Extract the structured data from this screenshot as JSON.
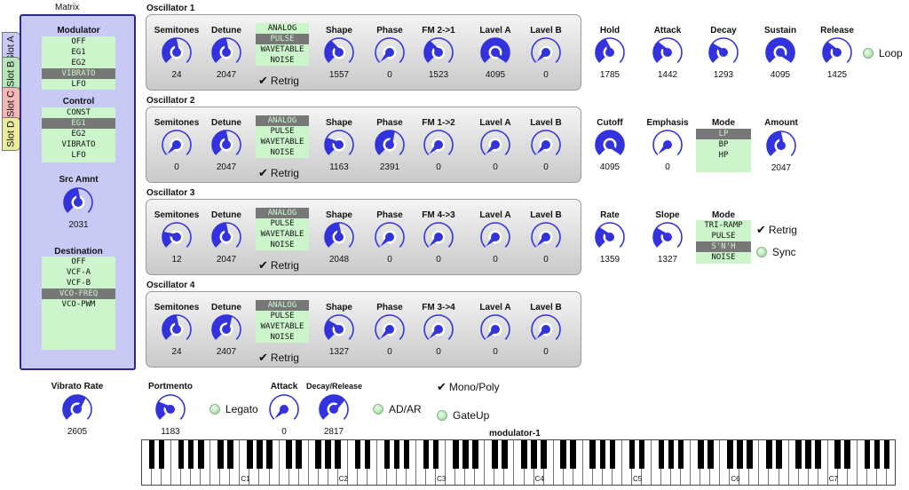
{
  "colors": {
    "knob_fill": "#3333dd",
    "lcd_bg": "#ccf5cc",
    "lcd_selected": "#777777",
    "matrix_bg": "#c9c9f5"
  },
  "matrix": {
    "title": "Matrix",
    "tabs": [
      {
        "label": "Slot A",
        "color": "#c9c9f5"
      },
      {
        "label": "Slot B",
        "color": "#b8e6b8"
      },
      {
        "label": "Slot C",
        "color": "#f2b8b8"
      },
      {
        "label": "Slot D",
        "color": "#ecec9c"
      }
    ],
    "modulator": {
      "label": "Modulator",
      "options": [
        "OFF",
        "EG1",
        "EG2",
        "VIBRATO",
        "LFO"
      ],
      "selected": 3
    },
    "control": {
      "label": "Control",
      "options": [
        "CONST",
        "EG1",
        "EG2",
        "VIBRATO",
        "LFO"
      ],
      "selected": 1
    },
    "src_amnt": {
      "label": "Src Amnt",
      "value": "2031",
      "fraction": 0.5
    },
    "destination": {
      "label": "Destination",
      "options": [
        "OFF",
        "VCF-A",
        "VCF-B",
        "VCO-FREQ",
        "VCO-PWM"
      ],
      "selected": 3
    }
  },
  "wave_options": [
    "ANALOG",
    "PULSE",
    "WAVETABLE",
    "NOISE"
  ],
  "oscillators": [
    {
      "title": "Oscillator 1",
      "wave_selected": 1,
      "retrig": "Retrig",
      "knobs": [
        {
          "label": "Semitones",
          "value": "24",
          "fraction": 0.5
        },
        {
          "label": "Detune",
          "value": "2047",
          "fraction": 0.5
        },
        {
          "label": "Shape",
          "value": "1557",
          "fraction": 0.38
        },
        {
          "label": "Phase",
          "value": "0",
          "fraction": 0.0
        },
        {
          "label": "FM 2->1",
          "value": "1523",
          "fraction": 0.37
        },
        {
          "label": "Lavel A",
          "value": "4095",
          "fraction": 1.0
        },
        {
          "label": "Lavel B",
          "value": "0",
          "fraction": 0.0
        }
      ]
    },
    {
      "title": "Oscillator 2",
      "wave_selected": 0,
      "retrig": "Retrig",
      "knobs": [
        {
          "label": "Semitones",
          "value": "0",
          "fraction": 0.0
        },
        {
          "label": "Detune",
          "value": "2047",
          "fraction": 0.5
        },
        {
          "label": "Shape",
          "value": "1163",
          "fraction": 0.28
        },
        {
          "label": "Phase",
          "value": "2391",
          "fraction": 0.58
        },
        {
          "label": "FM 1->2",
          "value": "0",
          "fraction": 0.0
        },
        {
          "label": "Lavel A",
          "value": "0",
          "fraction": 0.0
        },
        {
          "label": "Lavel B",
          "value": "0",
          "fraction": 0.0
        }
      ]
    },
    {
      "title": "Oscillator 3",
      "wave_selected": 0,
      "retrig": "Retrig",
      "knobs": [
        {
          "label": "Semitones",
          "value": "12",
          "fraction": 0.25
        },
        {
          "label": "Detune",
          "value": "2047",
          "fraction": 0.5
        },
        {
          "label": "Shape",
          "value": "2048",
          "fraction": 0.5
        },
        {
          "label": "Phase",
          "value": "0",
          "fraction": 0.0
        },
        {
          "label": "FM 4->3",
          "value": "0",
          "fraction": 0.0
        },
        {
          "label": "Lavel A",
          "value": "0",
          "fraction": 0.0
        },
        {
          "label": "Lavel B",
          "value": "0",
          "fraction": 0.0
        }
      ]
    },
    {
      "title": "Oscillator 4",
      "wave_selected": 0,
      "retrig": "Retrig",
      "knobs": [
        {
          "label": "Semitones",
          "value": "24",
          "fraction": 0.5
        },
        {
          "label": "Detune",
          "value": "2407",
          "fraction": 0.59
        },
        {
          "label": "Shape",
          "value": "1327",
          "fraction": 0.32
        },
        {
          "label": "Phase",
          "value": "0",
          "fraction": 0.0
        },
        {
          "label": "FM 3->4",
          "value": "0",
          "fraction": 0.0
        },
        {
          "label": "Lavel A",
          "value": "0",
          "fraction": 0.0
        },
        {
          "label": "Lavel B",
          "value": "0",
          "fraction": 0.0
        }
      ]
    }
  ],
  "envelope": {
    "knobs": [
      {
        "label": "Hold",
        "value": "1785",
        "fraction": 0.44
      },
      {
        "label": "Attack",
        "value": "1442",
        "fraction": 0.35
      },
      {
        "label": "Decay",
        "value": "1293",
        "fraction": 0.32
      },
      {
        "label": "Sustain",
        "value": "4095",
        "fraction": 1.0
      },
      {
        "label": "Release",
        "value": "1425",
        "fraction": 0.35
      }
    ],
    "loop_label": "Loop"
  },
  "filter": {
    "knobs": [
      {
        "label": "Cutoff",
        "value": "4095",
        "fraction": 1.0
      },
      {
        "label": "Emphasis",
        "value": "0",
        "fraction": 0.0
      }
    ],
    "mode_label": "Mode",
    "mode_options": [
      "LP",
      "BP",
      "HP"
    ],
    "mode_selected": 0,
    "amount": {
      "label": "Amount",
      "value": "2047",
      "fraction": 0.5
    }
  },
  "lfo": {
    "knobs": [
      {
        "label": "Rate",
        "value": "1359",
        "fraction": 0.33
      },
      {
        "label": "Slope",
        "value": "1327",
        "fraction": 0.32
      }
    ],
    "mode_label": "Mode",
    "mode_options": [
      "TRI-RAMP",
      "PULSE",
      "S'N'H",
      "NOISE"
    ],
    "mode_selected": 2,
    "retrig_label": "Retrig",
    "sync_label": "Sync"
  },
  "bottom": {
    "vibrato_rate": {
      "label": "Vibrato Rate",
      "value": "2605",
      "fraction": 0.64
    },
    "portmento": {
      "label": "Portmento",
      "value": "1183",
      "fraction": 0.29
    },
    "legato_label": "Legato",
    "attack": {
      "label": "Attack",
      "value": "0",
      "fraction": 0.0
    },
    "decay_release": {
      "label": "Decay/Release",
      "value": "2817",
      "fraction": 0.69
    },
    "adar_label": "AD/AR",
    "monopoly_label": "Mono/Poly",
    "gateup_label": "GateUp"
  },
  "keyboard": {
    "title": "modulator-1",
    "octave_labels": [
      "C1",
      "C2",
      "C3",
      "C4",
      "C5",
      "C6",
      "C7"
    ]
  }
}
